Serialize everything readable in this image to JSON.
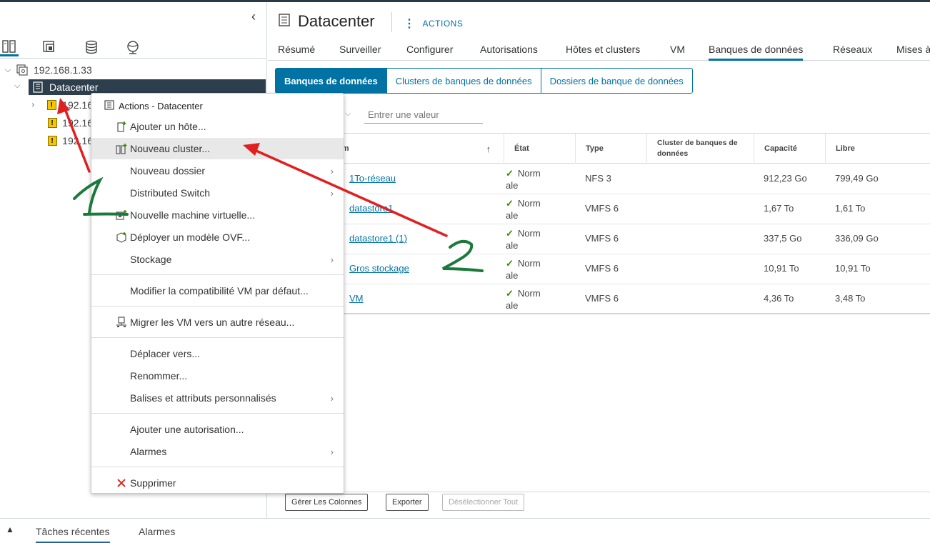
{
  "nav": {
    "host_ip": "192.168.1.33",
    "datacenter": "Datacenter",
    "hosts": [
      "192.16",
      "192.16",
      "192.16"
    ]
  },
  "header": {
    "title": "Datacenter",
    "actions_label": "ACTIONS"
  },
  "tabs": [
    "Résumé",
    "Surveiller",
    "Configurer",
    "Autorisations",
    "Hôtes et clusters",
    "VM",
    "Banques de données",
    "Réseaux",
    "Mises à"
  ],
  "subtabs": [
    "Banques de données",
    "Clusters de banques de données",
    "Dossiers de banque de données"
  ],
  "filter_placeholder": "Entrer une valeur",
  "table": {
    "columns": [
      "om",
      "État",
      "Type",
      "Cluster de banques de données",
      "Capacité",
      "Libre"
    ],
    "rows": [
      {
        "name": "1To-réseau",
        "state": "Normale",
        "state_a": "Norm",
        "state_b": "ale",
        "type": "NFS 3",
        "cluster": "",
        "capacity": "912,23 Go",
        "free": "799,49 Go"
      },
      {
        "name": "datastore1",
        "state": "Normale",
        "state_a": "Norm",
        "state_b": "ale",
        "type": "VMFS 6",
        "cluster": "",
        "capacity": "1,67 To",
        "free": "1,61 To"
      },
      {
        "name": "datastore1 (1)",
        "state": "Normale",
        "state_a": "Norm",
        "state_b": "ale",
        "type": "VMFS 6",
        "cluster": "",
        "capacity": "337,5 Go",
        "free": "336,09 Go"
      },
      {
        "name": "Gros stockage",
        "state": "Normale",
        "state_a": "Norm",
        "state_b": "ale",
        "type": "VMFS 6",
        "cluster": "",
        "capacity": "10,91 To",
        "free": "10,91 To"
      },
      {
        "name": "VM",
        "state": "Normale",
        "state_a": "Norm",
        "state_b": "ale",
        "type": "VMFS 6",
        "cluster": "",
        "capacity": "4,36 To",
        "free": "3,48 To"
      }
    ]
  },
  "footer": {
    "manage_columns": "Gérer Les Colonnes",
    "export": "Exporter",
    "deselect_all": "Désélectionner Tout"
  },
  "bottombar": {
    "recent_tasks": "Tâches récentes",
    "alarms": "Alarmes"
  },
  "context_menu": {
    "title": "Actions - Datacenter",
    "items": {
      "add_host": "Ajouter un hôte...",
      "new_cluster": "Nouveau cluster...",
      "new_folder": "Nouveau dossier",
      "distributed_switch": "Distributed Switch",
      "new_vm": "Nouvelle machine virtuelle...",
      "deploy_ovf": "Déployer un modèle OVF...",
      "storage": "Stockage",
      "modify_compat": "Modifier la compatibilité VM par défaut...",
      "migrate_vms": "Migrer les VM vers un autre réseau...",
      "move_to": "Déplacer vers...",
      "rename": "Renommer...",
      "tags": "Balises et attributs personnalisés",
      "add_permission": "Ajouter une autorisation...",
      "alarms": "Alarmes",
      "delete": "Supprimer"
    }
  },
  "annotations": {
    "label_1": "1",
    "label_2": "2",
    "arrow_color": "#e02020",
    "digit_color": "#1a7a3a"
  },
  "colors": {
    "accent": "#0072a3",
    "selected_row": "#2d3e4c",
    "success": "#3c8500"
  }
}
